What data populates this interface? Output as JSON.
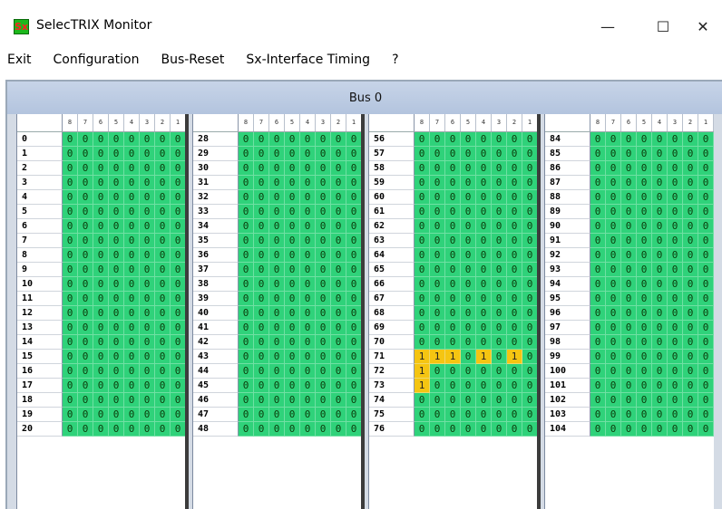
{
  "window": {
    "title": "SelecTRIX Monitor",
    "app_icon_text": "Sx",
    "minimize": "—",
    "maximize": "☐",
    "close": "✕"
  },
  "menu": [
    "Exit",
    "Configuration",
    "Bus-Reset",
    "Sx-Interface Timing",
    "?"
  ],
  "bus": {
    "title": "Bus 0",
    "bit_headers": [
      "8",
      "7",
      "6",
      "5",
      "4",
      "3",
      "2",
      "1"
    ],
    "columns": [
      {
        "addresses": [
          "0",
          "1",
          "2",
          "3",
          "4",
          "5",
          "6",
          "7",
          "8",
          "9",
          "10",
          "11",
          "12",
          "13",
          "14",
          "15",
          "16",
          "17",
          "18",
          "19",
          "20"
        ]
      },
      {
        "addresses": [
          "28",
          "29",
          "30",
          "31",
          "32",
          "33",
          "34",
          "35",
          "36",
          "37",
          "38",
          "39",
          "40",
          "41",
          "42",
          "43",
          "44",
          "45",
          "46",
          "47",
          "48"
        ]
      },
      {
        "addresses": [
          "56",
          "57",
          "58",
          "59",
          "60",
          "61",
          "62",
          "63",
          "64",
          "65",
          "66",
          "67",
          "68",
          "69",
          "70",
          "71",
          "72",
          "73",
          "74",
          "75",
          "76"
        ]
      },
      {
        "addresses": [
          "84",
          "85",
          "86",
          "87",
          "88",
          "89",
          "90",
          "91",
          "92",
          "93",
          "94",
          "95",
          "96",
          "97",
          "98",
          "99",
          "100",
          "101",
          "102",
          "103",
          "104"
        ]
      }
    ],
    "set_bits": {
      "71": [
        1,
        1,
        1,
        0,
        1,
        0,
        1,
        0
      ],
      "72": [
        1,
        0,
        0,
        0,
        0,
        0,
        0,
        0
      ],
      "73": [
        1,
        0,
        0,
        0,
        0,
        0,
        0,
        0
      ]
    },
    "colors": {
      "zero": "#2fd27a",
      "one": "#f5c512"
    }
  }
}
